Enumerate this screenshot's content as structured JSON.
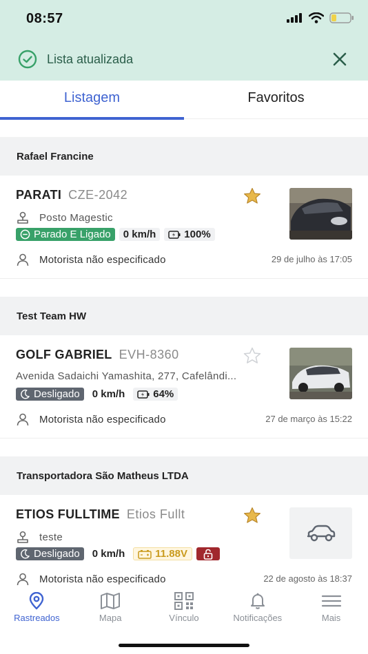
{
  "status_bar": {
    "time": "08:57"
  },
  "toast": {
    "message": "Lista atualizada"
  },
  "tabs": [
    {
      "label": "Listagem",
      "active": true
    },
    {
      "label": "Favoritos",
      "active": false
    }
  ],
  "groups": [
    {
      "name": "Rafael Francine",
      "vehicle": {
        "name": "PARATI",
        "plate": "CZE-2042",
        "favorite": true,
        "location": "Posto Magestic",
        "status": "Parado E Ligado",
        "speed": "0 km/h",
        "battery": "100%",
        "driver": "Motorista não especificado",
        "date": "29 de julho às 17:05"
      }
    },
    {
      "name": "Test Team HW",
      "vehicle": {
        "name": "GOLF GABRIEL",
        "plate": "EVH-8360",
        "favorite": false,
        "location": "Avenida Sadaichi Yamashita, 277, Cafelândi...",
        "status": "Desligado",
        "speed": "0 km/h",
        "battery": "64%",
        "driver": "Motorista não especificado",
        "date": "27 de março às 15:22"
      }
    },
    {
      "name": "Transportadora São Matheus LTDA",
      "vehicle": {
        "name": "ETIOS FULLTIME",
        "plate": "Etios Fullt",
        "favorite": true,
        "location": "teste",
        "status": "Desligado",
        "speed": "0 km/h",
        "voltage": "11.88V",
        "driver": "Motorista não especificado",
        "date": "22 de agosto às 18:37"
      }
    }
  ],
  "bottom_nav": [
    {
      "label": "Rastreados",
      "icon": "location-pin-icon",
      "active": true
    },
    {
      "label": "Mapa",
      "icon": "map-icon",
      "active": false
    },
    {
      "label": "Vínculo",
      "icon": "qr-code-icon",
      "active": false
    },
    {
      "label": "Notificações",
      "icon": "bell-icon",
      "active": false
    },
    {
      "label": "Mais",
      "icon": "menu-icon",
      "active": false
    }
  ],
  "colors": {
    "accent": "#3f63d1",
    "toast_bg": "#d5ede4",
    "status_green": "#38a169",
    "status_grey": "#5f6670",
    "star": "#e8b84a",
    "lock_red": "#a1282d"
  }
}
